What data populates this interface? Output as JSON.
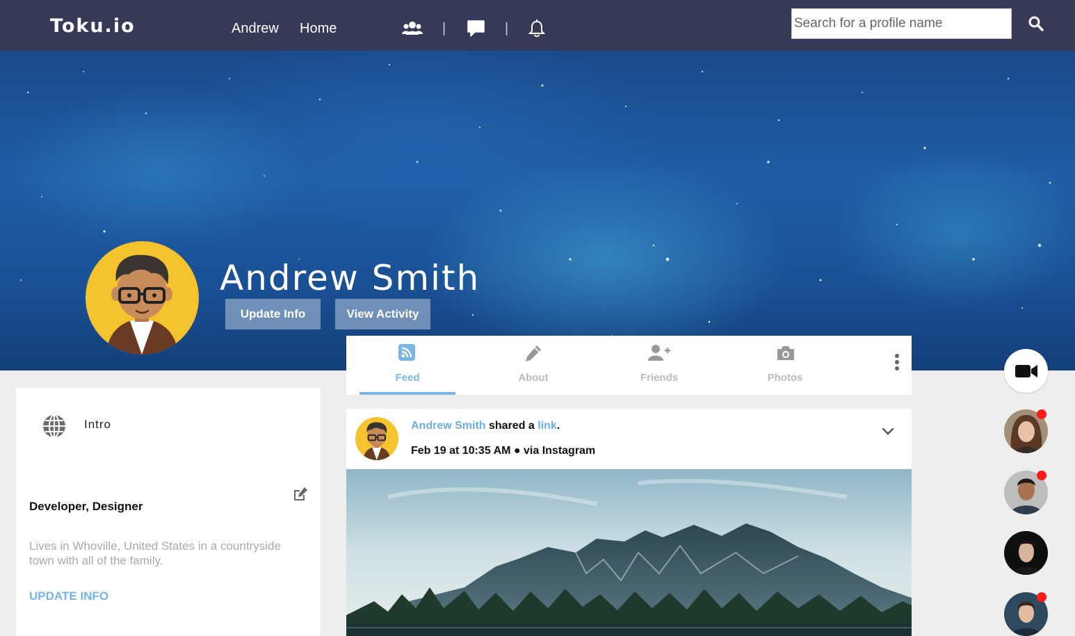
{
  "header": {
    "logo": "Toku.io",
    "nav": [
      "Andrew",
      "Home"
    ],
    "separator": "|",
    "search_placeholder": "Search for a profile name"
  },
  "profile": {
    "name": "Andrew Smith",
    "buttons": [
      "Update Info",
      "View Activity"
    ]
  },
  "tabs": [
    {
      "label": "Feed",
      "icon": "rss-icon",
      "active": true
    },
    {
      "label": "About",
      "icon": "pencil-icon",
      "active": false
    },
    {
      "label": "Friends",
      "icon": "add-user-icon",
      "active": false
    },
    {
      "label": "Photos",
      "icon": "camera-icon",
      "active": false
    }
  ],
  "intro": {
    "title": "Intro",
    "occupation": "Developer, Designer",
    "bio": "Lives in Whoville, United States in a countryside town with all of the family.",
    "update_label": "UPDATE INFO"
  },
  "post": {
    "author": "Andrew Smith",
    "action": " shared a ",
    "object": "link",
    "period": ".",
    "meta": "Feb 19 at 10:35 AM ● via Instagram"
  },
  "colors": {
    "topbar": "#363a56",
    "accent": "#7ab5e8",
    "notification": "#ff1a1a"
  }
}
